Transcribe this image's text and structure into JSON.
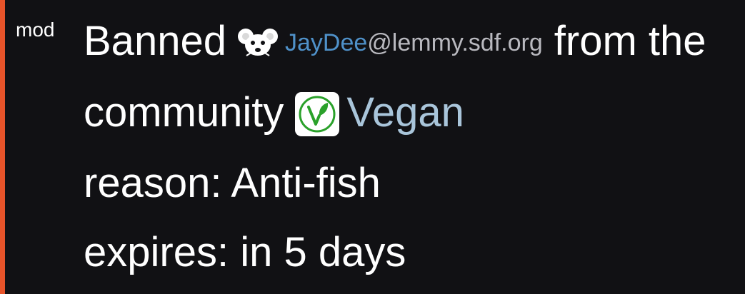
{
  "mod_tag": "mod",
  "entry": {
    "action": "Banned",
    "user": {
      "name": "JayDee",
      "instance": "@lemmy.sdf.org",
      "icon": "mouse-avatar-icon"
    },
    "from_text": "from the",
    "community_label": "community",
    "community": {
      "name": "Vegan",
      "icon": "vegan-v-leaf-icon"
    },
    "reason": "reason: Anti-fish",
    "expires": "expires: in 5 days"
  },
  "colors": {
    "accent": "#e8542a",
    "background": "#111114",
    "user_link": "#4f91c9",
    "instance_text": "#b9b9bf",
    "community_link": "#a9c5da",
    "vegan_green": "#2aa12a"
  }
}
